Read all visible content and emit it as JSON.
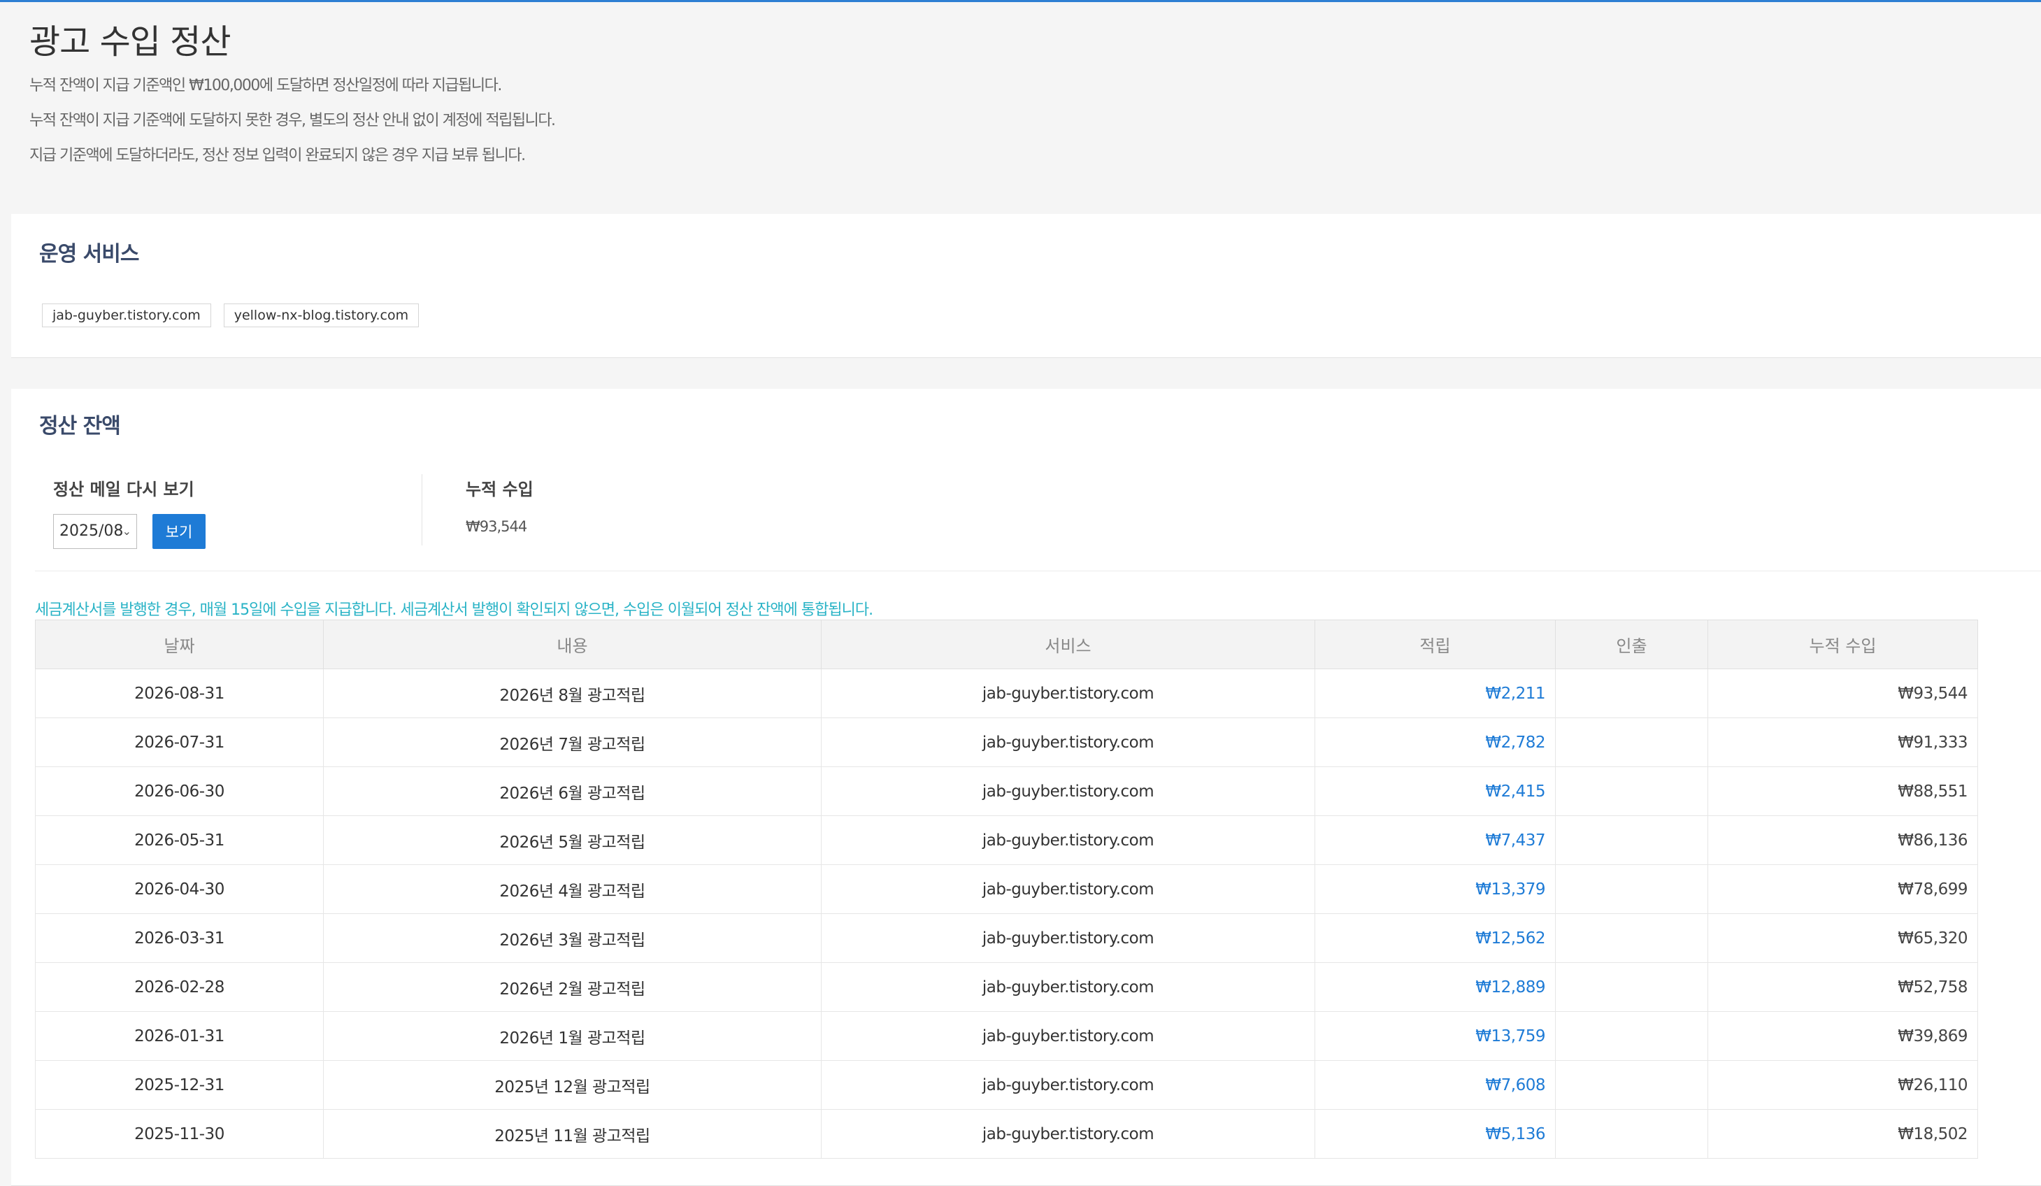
{
  "header": {
    "title": "광고 수입 정산",
    "notices": [
      "누적 잔액이 지급 기준액인 ₩100,000에 도달하면 정산일정에 따라 지급됩니다.",
      "누적 잔액이 지급 기준액에 도달하지 못한 경우, 별도의 정산 안내 없이 계정에 적립됩니다.",
      "지급 기준액에 도달하더라도, 정산 정보 입력이 완료되지 않은 경우 지급 보류 됩니다."
    ]
  },
  "services": {
    "title": "운영 서비스",
    "items": [
      "jab-guyber.tistory.com",
      "yellow-nx-blog.tistory.com"
    ]
  },
  "balance": {
    "title": "정산 잔액",
    "mail_label": "정산 메일 다시 보기",
    "selected_month": "2025/08",
    "view_button": "보기",
    "cumulative_label": "누적 수입",
    "cumulative_value": "₩93,544",
    "tax_notice": "세금계산서를 발행한 경우, 매월 15일에 수입을 지급합니다. 세금계산서 발행이 확인되지 않으면, 수입은 이월되어 정산 잔액에 통합됩니다."
  },
  "ledger": {
    "columns": [
      "날짜",
      "내용",
      "서비스",
      "적립",
      "인출",
      "누적 수입"
    ],
    "rows": [
      {
        "date": "2026-08-31",
        "content": "2026년 8월 광고적립",
        "service": "jab-guyber.tistory.com",
        "deposit": "₩2,211",
        "withdrawal": "",
        "cumulative": "₩93,544"
      },
      {
        "date": "2026-07-31",
        "content": "2026년 7월 광고적립",
        "service": "jab-guyber.tistory.com",
        "deposit": "₩2,782",
        "withdrawal": "",
        "cumulative": "₩91,333"
      },
      {
        "date": "2026-06-30",
        "content": "2026년 6월 광고적립",
        "service": "jab-guyber.tistory.com",
        "deposit": "₩2,415",
        "withdrawal": "",
        "cumulative": "₩88,551"
      },
      {
        "date": "2026-05-31",
        "content": "2026년 5월 광고적립",
        "service": "jab-guyber.tistory.com",
        "deposit": "₩7,437",
        "withdrawal": "",
        "cumulative": "₩86,136"
      },
      {
        "date": "2026-04-30",
        "content": "2026년 4월 광고적립",
        "service": "jab-guyber.tistory.com",
        "deposit": "₩13,379",
        "withdrawal": "",
        "cumulative": "₩78,699"
      },
      {
        "date": "2026-03-31",
        "content": "2026년 3월 광고적립",
        "service": "jab-guyber.tistory.com",
        "deposit": "₩12,562",
        "withdrawal": "",
        "cumulative": "₩65,320"
      },
      {
        "date": "2026-02-28",
        "content": "2026년 2월 광고적립",
        "service": "jab-guyber.tistory.com",
        "deposit": "₩12,889",
        "withdrawal": "",
        "cumulative": "₩52,758"
      },
      {
        "date": "2026-01-31",
        "content": "2026년 1월 광고적립",
        "service": "jab-guyber.tistory.com",
        "deposit": "₩13,759",
        "withdrawal": "",
        "cumulative": "₩39,869"
      },
      {
        "date": "2025-12-31",
        "content": "2025년 12월 광고적립",
        "service": "jab-guyber.tistory.com",
        "deposit": "₩7,608",
        "withdrawal": "",
        "cumulative": "₩26,110"
      },
      {
        "date": "2025-11-30",
        "content": "2025년 11월 광고적립",
        "service": "jab-guyber.tistory.com",
        "deposit": "₩5,136",
        "withdrawal": "",
        "cumulative": "₩18,502"
      }
    ]
  },
  "colors": {
    "accent": "#1e7bd6",
    "notice_teal": "#29b3c6",
    "top_line": "#2d7fd3"
  },
  "icons": {
    "select_arrow": "chevron-down-icon"
  }
}
